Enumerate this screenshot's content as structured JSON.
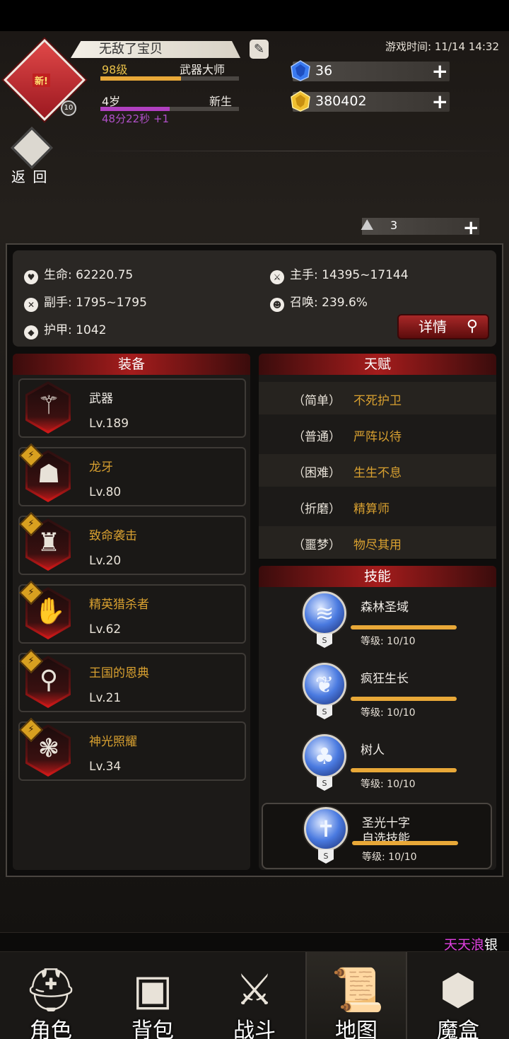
{
  "player": {
    "name": "无敌了宝贝",
    "new_badge": "新!",
    "avatar_level": "10",
    "level_text": "98级",
    "level_fill": 0.58,
    "title": "武器大师",
    "age_text": "4岁",
    "age_fill": 0.5,
    "age_stage": "新生",
    "age_timer": "48分22秒 +1"
  },
  "game_time": "游戏时间: 11/14 14:32",
  "resources": {
    "gems": "36",
    "gold": "380402",
    "tokens": "3"
  },
  "back_label": "返 回",
  "stats": {
    "life": "生命: 62220.75",
    "main_hand": "主手: 14395~17144",
    "off_hand": "副手: 1795~1795",
    "summon": "召唤: 239.6%",
    "armor": "护甲: 1042",
    "detail_button": "详情"
  },
  "equipment": {
    "header": "装备",
    "items": [
      {
        "name": "武器",
        "level": "Lv.189",
        "icon": "staff-icon",
        "rune": false
      },
      {
        "name": "龙牙",
        "level": "Lv.80",
        "icon": "hat-icon",
        "rune": true
      },
      {
        "name": "致命袭击",
        "level": "Lv.20",
        "icon": "chest-armor-icon",
        "rune": true
      },
      {
        "name": "精英猎杀者",
        "level": "Lv.62",
        "icon": "gloves-icon",
        "rune": true
      },
      {
        "name": "王国的恩典",
        "level": "Lv.21",
        "icon": "boots-icon",
        "rune": true
      },
      {
        "name": "神光照耀",
        "level": "Lv.34",
        "icon": "amulet-icon",
        "rune": true
      }
    ]
  },
  "talents": {
    "header": "天赋",
    "items": [
      {
        "difficulty": "（简单）",
        "name": "不死护卫"
      },
      {
        "difficulty": "（普通）",
        "name": "严阵以待"
      },
      {
        "difficulty": "（困难）",
        "name": "生生不息"
      },
      {
        "difficulty": "（折磨）",
        "name": "精算师"
      },
      {
        "difficulty": "（噩梦）",
        "name": "物尽其用"
      }
    ]
  },
  "skills": {
    "header": "技能",
    "items": [
      {
        "name": "森林圣域",
        "sub": "",
        "level": "等级: 10/10",
        "tag": "S",
        "icon": "forest-sanctuary-icon"
      },
      {
        "name": "疯狂生长",
        "sub": "",
        "level": "等级: 10/10",
        "tag": "S",
        "icon": "wild-growth-icon"
      },
      {
        "name": "树人",
        "sub": "",
        "level": "等级: 10/10",
        "tag": "S",
        "icon": "treant-icon"
      },
      {
        "name": "圣光十字",
        "sub": "自选技能",
        "level": "等级: 10/10",
        "tag": "S",
        "icon": "holy-cross-icon"
      }
    ]
  },
  "ticker": {
    "part1": "天天浪",
    "part2": "银"
  },
  "nav": [
    {
      "label": "角色",
      "icon": "helmet-icon",
      "active": false
    },
    {
      "label": "背包",
      "icon": "backpack-icon",
      "active": false
    },
    {
      "label": "战斗",
      "icon": "sword-shield-icon",
      "active": false
    },
    {
      "label": "地图",
      "icon": "scroll-map-icon",
      "active": true
    },
    {
      "label": "魔盒",
      "icon": "magic-box-icon",
      "active": false
    }
  ],
  "colors": {
    "accent_red": "#a41c1c",
    "talent_gold": "#d8a030",
    "level_bar": "#e8a838",
    "age_bar": "#b040c0"
  }
}
